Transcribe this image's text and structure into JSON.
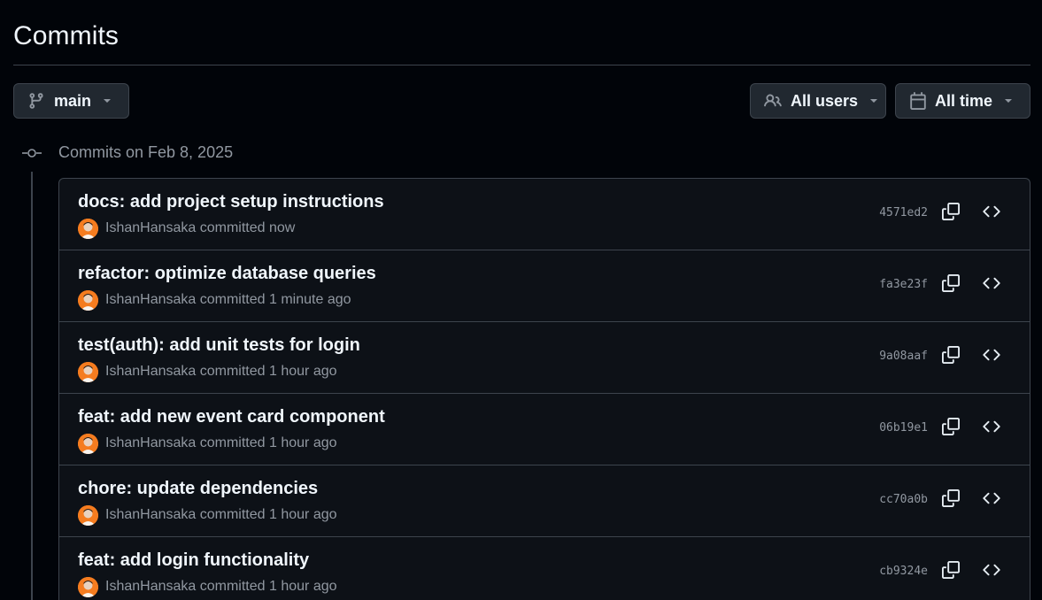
{
  "page": {
    "title": "Commits"
  },
  "filters": {
    "branch": {
      "label": "main",
      "icon": "git-branch-icon"
    },
    "users": {
      "label": "All users",
      "icon": "people-icon"
    },
    "time": {
      "label": "All time",
      "icon": "calendar-icon"
    }
  },
  "group": {
    "label": "Commits on Feb 8, 2025",
    "icon": "git-commit-icon"
  },
  "commits": [
    {
      "message": "docs: add project setup instructions",
      "author": "IshanHansaka",
      "action": "committed",
      "time": "now",
      "sha": "4571ed2"
    },
    {
      "message": "refactor: optimize database queries",
      "author": "IshanHansaka",
      "action": "committed",
      "time": "1 minute ago",
      "sha": "fa3e23f"
    },
    {
      "message": "test(auth): add unit tests for login",
      "author": "IshanHansaka",
      "action": "committed",
      "time": "1 hour ago",
      "sha": "9a08aaf"
    },
    {
      "message": "feat: add new event card component",
      "author": "IshanHansaka",
      "action": "committed",
      "time": "1 hour ago",
      "sha": "06b19e1"
    },
    {
      "message": "chore: update dependencies",
      "author": "IshanHansaka",
      "action": "committed",
      "time": "1 hour ago",
      "sha": "cc70a0b"
    },
    {
      "message": "feat: add login functionality",
      "author": "IshanHansaka",
      "action": "committed",
      "time": "1 hour ago",
      "sha": "cb9324e"
    }
  ],
  "colors": {
    "background": "#010409",
    "row_background": "#0d1117",
    "border": "#3d444d",
    "text_primary": "#f0f6fc",
    "text_muted": "#9198a1",
    "avatar_accent": "#f57c1f"
  }
}
